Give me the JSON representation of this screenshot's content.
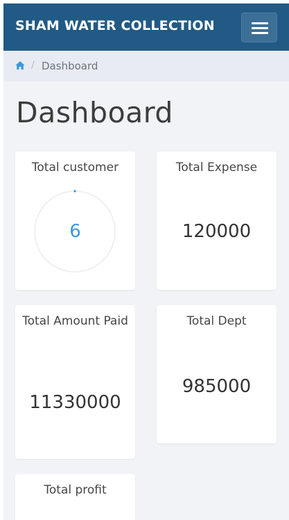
{
  "header": {
    "brand": "SHAM WATER COLLECTION",
    "menu_icon": "hamburger-menu-icon"
  },
  "breadcrumb": {
    "home_icon": "home-icon",
    "separator": "/",
    "current": "Dashboard"
  },
  "page": {
    "title": "Dashboard"
  },
  "cards": {
    "total_customer": {
      "label": "Total customer",
      "value": "6"
    },
    "total_expense": {
      "label": "Total Expense",
      "value": "120000"
    },
    "total_amount_paid": {
      "label": "Total Amount Paid",
      "value": "11330000"
    },
    "total_dept": {
      "label": "Total Dept",
      "value": "985000"
    },
    "total_profit": {
      "label": "Total profit"
    }
  },
  "colors": {
    "navbar": "#215a84",
    "accent": "#3b97dc",
    "background": "#f1f3f7"
  }
}
